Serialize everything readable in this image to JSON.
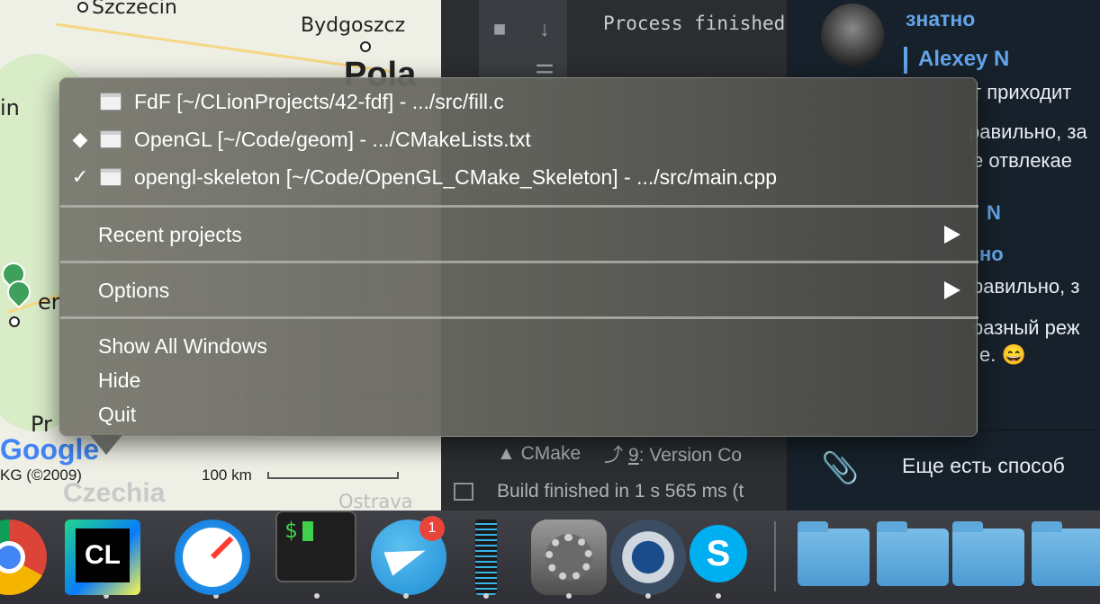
{
  "map": {
    "cities": [
      "Szczecin",
      "Bydgoszcz"
    ],
    "partial_labels": [
      "Pola",
      "in",
      "er",
      "Pr",
      "Czechia",
      "Ostrava"
    ],
    "google_logo": "Google",
    "copyright": "KG (©2009)",
    "scale": "100 km"
  },
  "ide": {
    "console": "Process finished",
    "toolbar": {
      "cmake": "CMake",
      "version_control_number": "9",
      "version_control": ": Version Co"
    },
    "status": "Build finished in 1 s 565 ms (t"
  },
  "chat": {
    "sender1": "знатно",
    "reply_name": "Alexey N",
    "lines": [
      "т приходит",
      "равильно, за",
      "е отвлекае",
      "N",
      "но",
      "равильно, з",
      "разный реж",
      "е. 😄"
    ],
    "input_text": "Еще есть способ"
  },
  "menu": {
    "windows": [
      {
        "mark": "",
        "label": "FdF [~/CLionProjects/42-fdf] - .../src/fill.c"
      },
      {
        "mark": "◆",
        "label": "OpenGL [~/Code/geom] - .../CMakeLists.txt"
      },
      {
        "mark": "✓",
        "label": "opengl-skeleton [~/Code/OpenGL_CMake_Skeleton] - .../src/main.cpp"
      }
    ],
    "recent_projects": "Recent projects",
    "options": "Options",
    "show_all_windows": "Show All Windows",
    "hide": "Hide",
    "quit": "Quit"
  },
  "dock": {
    "apps": [
      "Chrome",
      "CLion",
      "Safari",
      "Terminal",
      "Telegram",
      "Activity Monitor",
      "System Preferences",
      "QuickTime Player",
      "Skype"
    ],
    "clion_text": "CL",
    "terminal_text": "$",
    "telegram_badge": "1"
  }
}
